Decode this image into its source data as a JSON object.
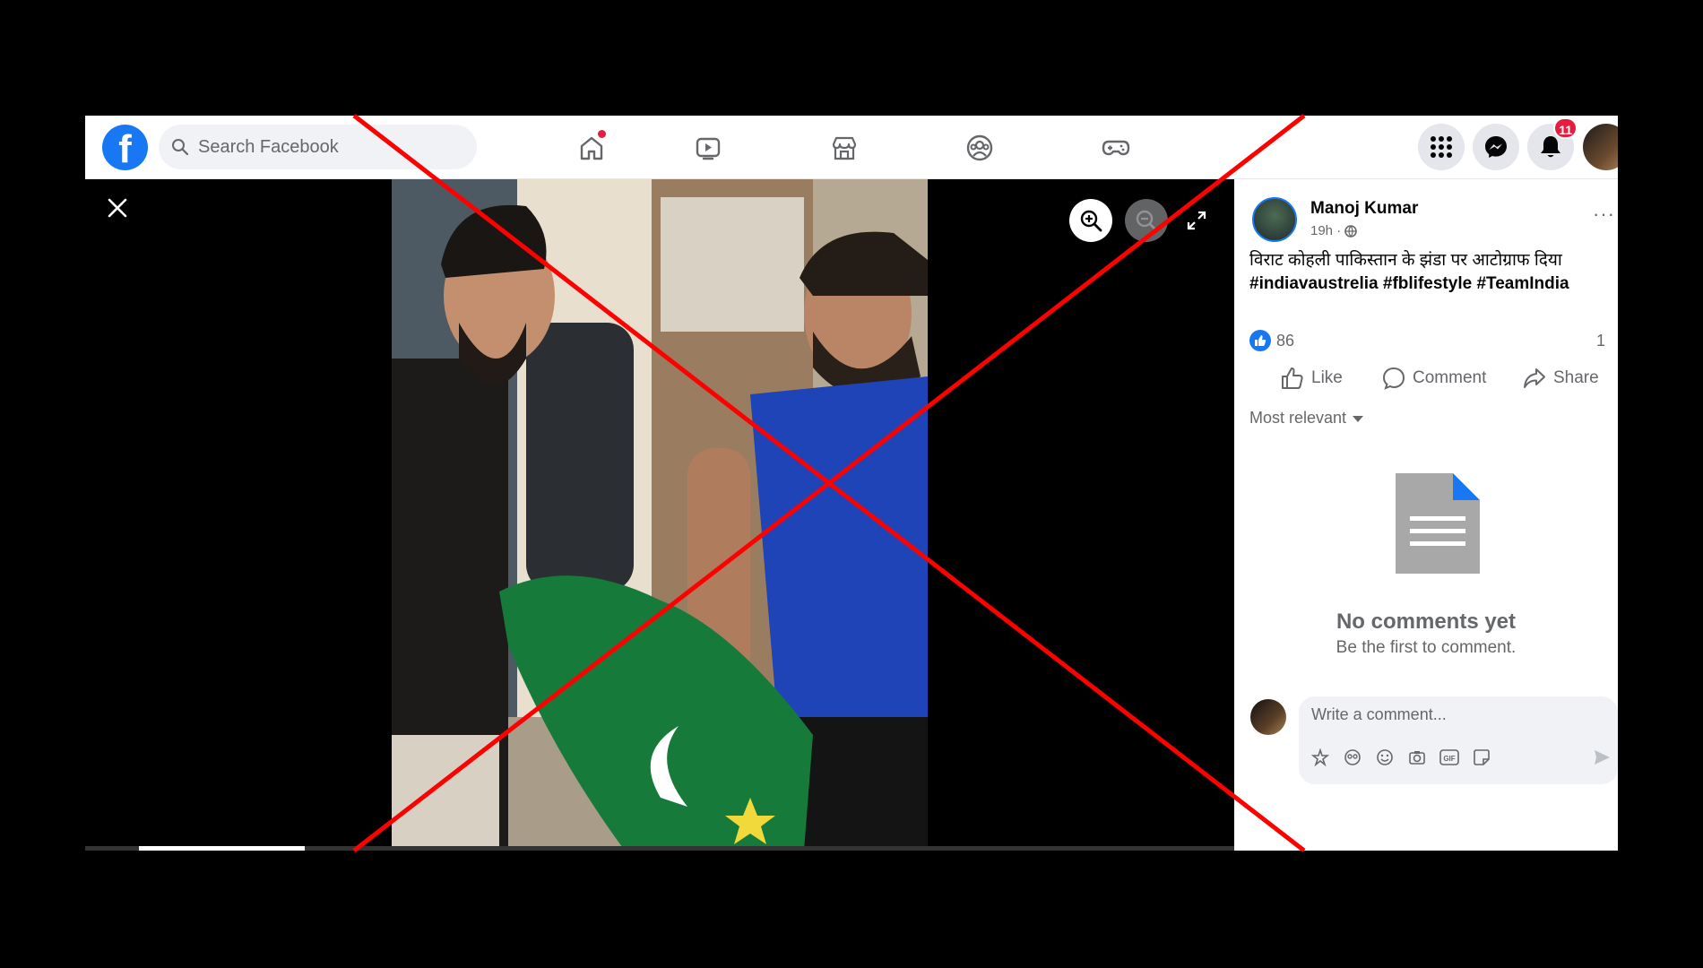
{
  "search": {
    "placeholder": "Search Facebook"
  },
  "nav": {
    "icons": [
      "home-icon",
      "video-icon",
      "marketplace-icon",
      "groups-icon",
      "gaming-icon"
    ],
    "home_has_notification_dot": true
  },
  "header_right": {
    "menu_icon": "grid-menu-icon",
    "messenger_icon": "messenger-icon",
    "notifications_icon": "bell-icon",
    "notifications_count": "11"
  },
  "viewer": {
    "close_icon": "close-icon",
    "zoom_in_icon": "zoom-in-icon",
    "zoom_out_icon": "zoom-out-icon",
    "fullscreen_icon": "fullscreen-icon",
    "progress": 0.06
  },
  "post": {
    "author": "Manoj Kumar",
    "time": "19h ·",
    "audience_icon": "globe-icon",
    "more_label": "···",
    "caption": "विराट कोहली पाकिस्तान के झंडा पर आटोग्राफ दिया",
    "hashtags": "#indiavaustrelia #fblifestyle #TeamIndia",
    "reaction_count": "86",
    "comment_count": "1",
    "actions": {
      "like": "Like",
      "comment": "Comment",
      "share": "Share"
    },
    "sort_label": "Most relevant"
  },
  "comments": {
    "empty_title": "No comments yet",
    "empty_subtitle": "Be the first to comment.",
    "composer_placeholder": "Write a comment...",
    "composer_icons": [
      "avatar-sticker-icon",
      "emoji-sticker-icon",
      "smiley-icon",
      "camera-icon",
      "gif-icon",
      "sticker-icon"
    ],
    "send_icon": "send-icon"
  },
  "colors": {
    "brand": "#1877f2",
    "overlay_cross": "#ff0000",
    "badge": "#e41e3f"
  }
}
